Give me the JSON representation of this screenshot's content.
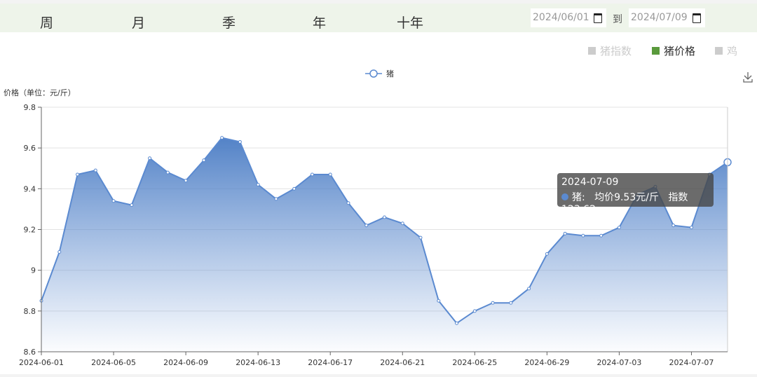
{
  "periods": [
    "周",
    "月",
    "季",
    "年",
    "十年"
  ],
  "date_range": {
    "start": "2024/06/01",
    "separator": "到",
    "end": "2024/07/09"
  },
  "toggles": [
    {
      "label": "猪指数",
      "active": false
    },
    {
      "label": "猪价格",
      "active": true
    },
    {
      "label": "鸡",
      "active": false
    }
  ],
  "colors": {
    "series": "#5b8ad0",
    "active_toggle": "#5a9a3c",
    "header_bg": "#eef4ea"
  },
  "download_icon": "download-icon",
  "tooltip": {
    "date": "2024-07-09",
    "series": "猪:",
    "price": "均价9.53元/斤",
    "index": "指数123.62"
  },
  "chart_data": {
    "type": "area",
    "ylabel": "价格（单位：元/斤）",
    "legend": {
      "name": "猪",
      "placement": "top-center"
    },
    "ylim": [
      8.6,
      9.8
    ],
    "yticks": [
      "8.6",
      "8.8",
      "9",
      "9.2",
      "9.4",
      "9.6",
      "9.8"
    ],
    "xticks": [
      "2024-06-01",
      "2024-06-05",
      "2024-06-09",
      "2024-06-13",
      "2024-06-17",
      "2024-06-21",
      "2024-06-25",
      "2024-06-29",
      "2024-07-03",
      "2024-07-07"
    ],
    "grid": true,
    "start_date": "2024-06-01",
    "series": [
      {
        "name": "猪",
        "values": [
          8.85,
          9.09,
          9.47,
          9.49,
          9.34,
          9.32,
          9.55,
          9.48,
          9.44,
          9.54,
          9.65,
          9.63,
          9.42,
          9.35,
          9.4,
          9.47,
          9.47,
          9.33,
          9.22,
          9.26,
          9.23,
          9.16,
          8.85,
          8.74,
          8.8,
          8.84,
          8.84,
          8.91,
          9.08,
          9.18,
          9.17,
          9.17,
          9.21,
          9.37,
          9.41,
          9.22,
          9.21,
          9.47,
          9.53
        ]
      }
    ]
  }
}
